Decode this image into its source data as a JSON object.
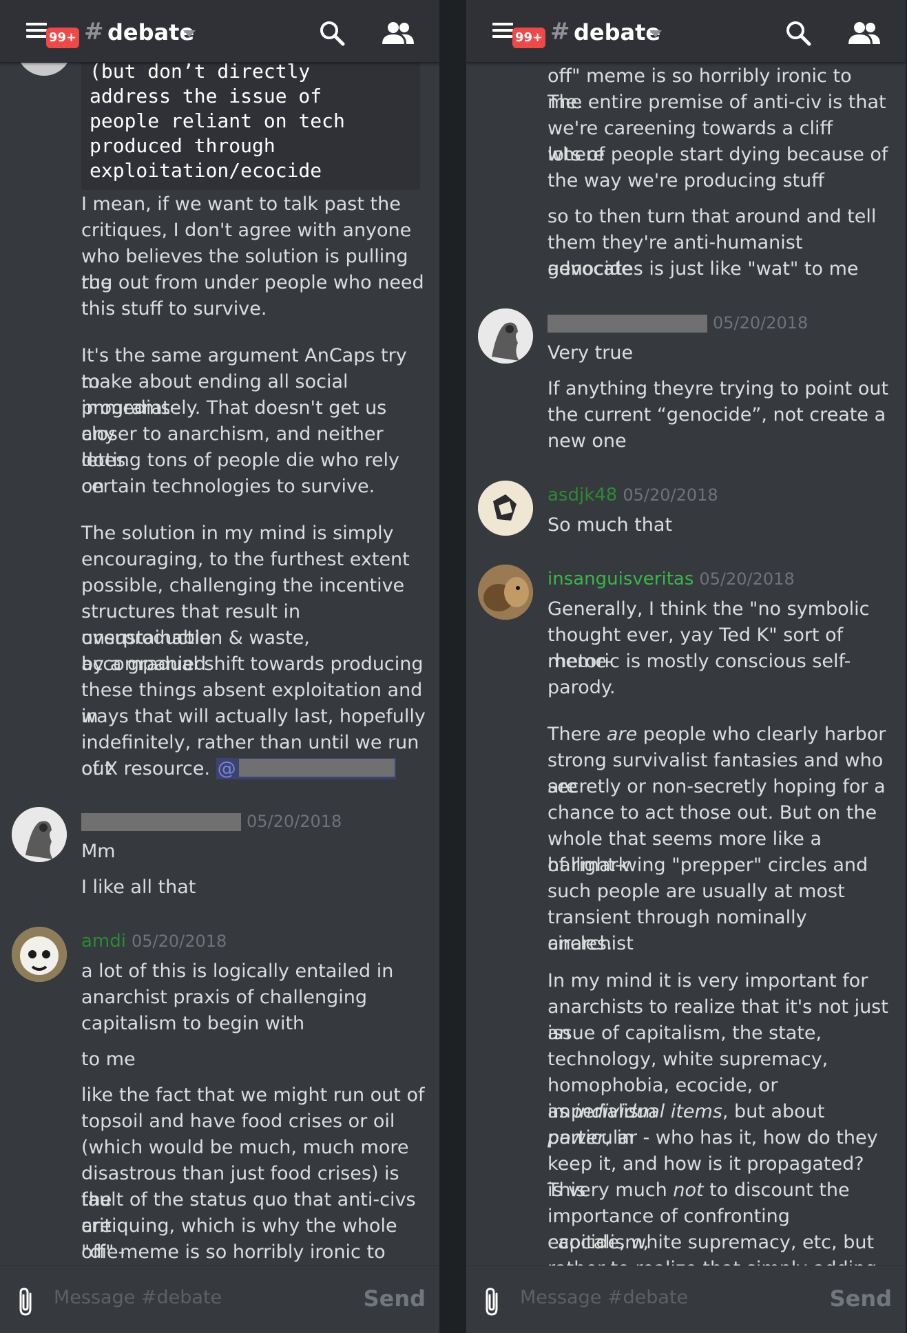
{
  "header": {
    "badge": "99+",
    "hash": "#",
    "channel": "debate",
    "icons": [
      "hamburger-icon",
      "search-icon",
      "members-icon",
      "chevron-down-icon"
    ]
  },
  "composer": {
    "placeholder": "Message #debate",
    "send_label": "Send",
    "icon": "paperclip-icon"
  },
  "left": {
    "code_lines": [
      "(but don’t directly",
      "address the issue of",
      "people reliant on tech",
      "produced through",
      "exploitation/ecocide"
    ],
    "cont_paragraphs": [
      [
        " I mean, if we want to talk past the",
        "critiques, I don't agree with anyone",
        "who believes the solution is pulling the",
        "rug out from under people who need",
        "this stuff to survive."
      ],
      [
        "It's the same argument AnCaps try to",
        "make about ending all social programs",
        "immediately. That doesn't get us any",
        "closer to anarchism, and neither does",
        "letting tons of people die who rely on",
        "certain technologies to survive."
      ],
      [
        "The solution in my mind is simply",
        "encouraging, to the furthest extent",
        "possible, challenging the incentive",
        "structures that result in unsustainable",
        "overproduction & waste, accompanied",
        "by a gradual shift towards producing",
        "these things absent exploitation and in",
        "ways that will actually last, hopefully",
        "indefinitely, rather than until we run out"
      ]
    ],
    "last_line_prefix": "of X resource. ",
    "mention_at": "@",
    "msg1": {
      "date": "05/20/2018",
      "lines": [
        "Mm",
        "I like all that"
      ]
    },
    "msg2": {
      "user": "amdi",
      "date": "05/20/2018",
      "paragraphs": [
        [
          "a lot of this is logically entailed in",
          "anarchist praxis of challenging",
          "capitalism to begin with"
        ],
        [
          "to me"
        ],
        [
          "like the fact that we might run out of",
          "topsoil and have food crises or oil",
          "(which would be much, much more",
          "disastrous than just food crises)  is the",
          "fault of the status quo that anti-civs are",
          "critiquing, which is why the whole \"die-",
          "off\" meme is so horribly ironic to me."
        ]
      ]
    }
  },
  "right": {
    "top_lines": [
      "off\" meme is so horribly ironic to me.",
      "The entire premise of anti-civ is that",
      "we're careening towards a cliff where",
      "lots of people start dying because of",
      "the way we're producing stuff"
    ],
    "top_lines2": [
      "so to then turn that around and tell",
      "them they're anti-humanist genocide",
      "advocates is just like \"wat\" to me"
    ],
    "msg1": {
      "date": "05/20/2018",
      "line1": "Very true",
      "lines2": [
        "If anything theyre trying to point out",
        "the current “genocide”, not create a",
        "new one"
      ]
    },
    "msg2": {
      "user": "asdjk48",
      "date": "05/20/2018",
      "line": "So much that"
    },
    "msg3": {
      "user": "insanguisveritas",
      "date": "05/20/2018",
      "p1": [
        "Generally, I think the \"no symbolic",
        "thought ever, yay Ted K\" sort of meme-",
        "rhetoric is mostly conscious self-",
        "parody."
      ],
      "p2_first_a": "There ",
      "p2_first_em": "are",
      "p2_first_b": " people who clearly harbor",
      "p2_rest": [
        "strong survivalist fantasies and who are",
        "secretly or non-secretly hoping for a",
        "chance to act those out. But on the",
        "whole that seems more like a hallmark",
        "of right-wing \"prepper\" circles and",
        "such people are usually at most",
        "transient through nominally anarchist",
        "circles."
      ],
      "p3_a": [
        "In my mind it is very important for",
        "anarchists to realize that it's not just an",
        "issue of capitalism, the state,",
        "technology, white supremacy,",
        "homophobia, ecocide, or imperialism"
      ],
      "p3_l6_a": "as ",
      "p3_l6_em": "individual items",
      "p3_l6_b": ", but about ",
      "p3_l6_em2": "power",
      "p3_l6_c": ", in",
      "p3_b": [
        "particular - who has it, how do they",
        "keep it, and how is it propagated? This"
      ],
      "p3_l9_a": "is very much ",
      "p3_l9_em": "not",
      "p3_l9_b": " to discount the",
      "p3_c": [
        "importance of confronting capitalism,",
        "ecocide, white supremacy,  etc, but",
        "rather to realize that simply adding"
      ]
    }
  }
}
